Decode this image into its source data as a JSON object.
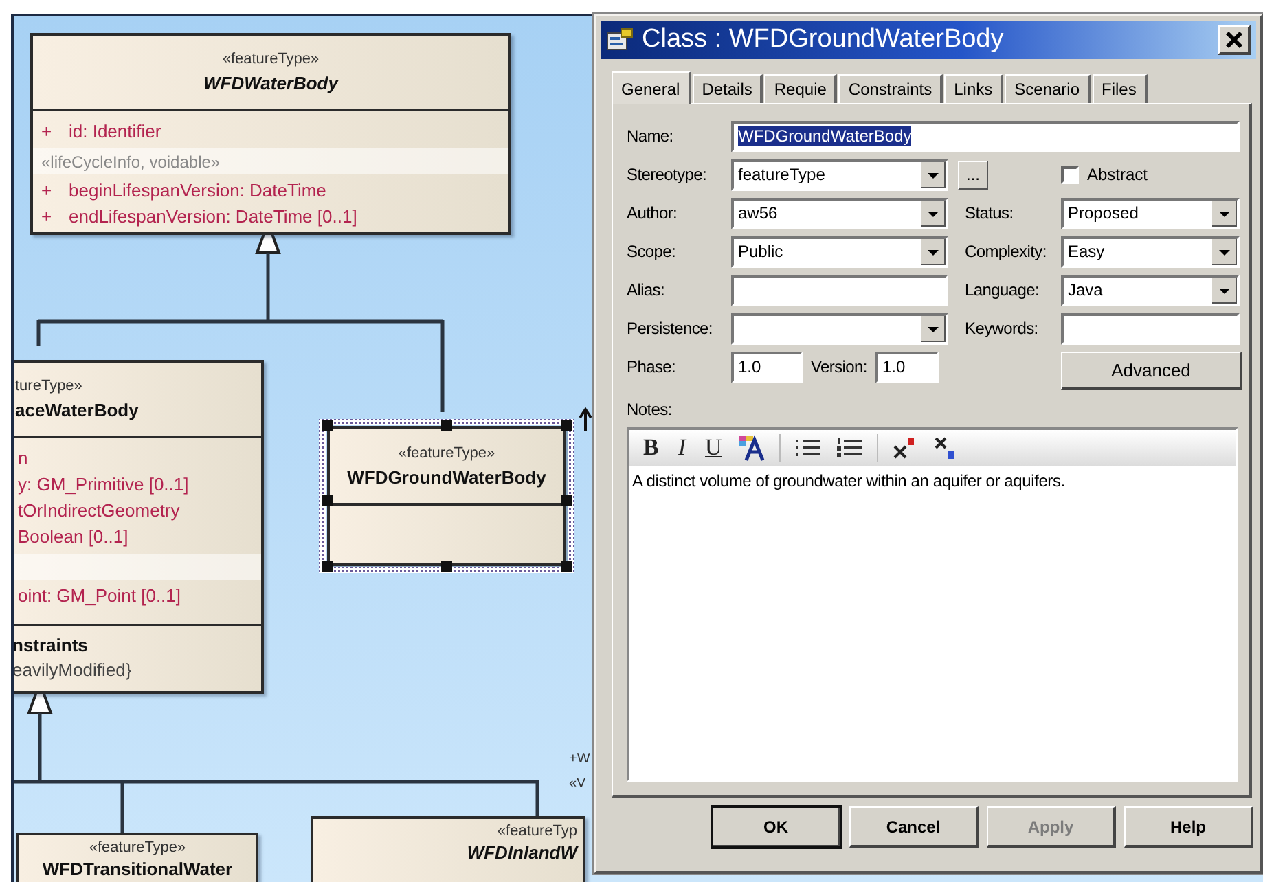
{
  "diagram": {
    "classes": [
      {
        "stereotype": "«featureType»",
        "name": "WFDWaterBody",
        "abstract": true,
        "selected": false,
        "attributes": [
          {
            "kind": "attribute",
            "visibility": "+",
            "text": "id: Identifier"
          },
          {
            "kind": "band",
            "text": "«lifeCycleInfo, voidable»"
          },
          {
            "kind": "attribute",
            "visibility": "+",
            "text": "beginLifespanVersion:  DateTime"
          },
          {
            "kind": "attribute",
            "visibility": "+",
            "text": "endLifespanVersion:  DateTime [0..1]"
          }
        ]
      },
      {
        "stereotype": "tureType»",
        "name": "aceWaterBody",
        "abstract": false,
        "selected": false,
        "attributes": [
          {
            "kind": "attribute",
            "text": "n"
          },
          {
            "kind": "attribute",
            "text": "y:  GM_Primitive [0..1]"
          },
          {
            "kind": "attribute",
            "text": "tOrIndirectGeometry"
          },
          {
            "kind": "attribute",
            "text": "Boolean [0..1]"
          },
          {
            "kind": "band"
          },
          {
            "kind": "attribute",
            "text": "oint:  GM_Point [0..1]"
          }
        ],
        "constraints": {
          "title": "nstraints",
          "items": [
            "eavilyModified}"
          ]
        }
      },
      {
        "stereotype": "«featureType»",
        "name": "WFDGroundWaterBody",
        "abstract": false,
        "selected": true
      },
      {
        "stereotype": "«featureType»",
        "name": "WFDTransitionalWater",
        "abstract": false,
        "selected": false
      },
      {
        "stereotype": "«featureTyp",
        "name": "WFDInlandW",
        "abstract": true,
        "selected": false
      }
    ],
    "labels": [
      {
        "text": "+W"
      },
      {
        "text": "«V"
      }
    ]
  },
  "dialog": {
    "title": "Class : WFDGroundWaterBody",
    "tabs": [
      {
        "label": "General",
        "selected": true
      },
      {
        "label": "Details",
        "selected": false
      },
      {
        "label": "Requie",
        "selected": false
      },
      {
        "label": "Constraints",
        "selected": false
      },
      {
        "label": "Links",
        "selected": false
      },
      {
        "label": "Scenario",
        "selected": false
      },
      {
        "label": "Files",
        "selected": false
      }
    ],
    "name": {
      "label": "Name:",
      "value": "WFDGroundWaterBody",
      "selected": true
    },
    "left_fields": [
      {
        "label": "Stereotype:",
        "kind": "combo",
        "value": "featureType"
      },
      {
        "label": "Author:",
        "kind": "combo",
        "value": "aw56"
      },
      {
        "label": "Scope:",
        "kind": "combo",
        "value": "Public"
      },
      {
        "label": "Alias:",
        "kind": "text"
      },
      {
        "label": "Persistence:",
        "kind": "combo"
      }
    ],
    "browse_button": "...",
    "abstract": {
      "label": "Abstract",
      "checked": false
    },
    "right_fields": [
      {
        "label": "Status:",
        "kind": "combo",
        "value": "Proposed"
      },
      {
        "label": "Complexity:",
        "kind": "combo",
        "value": "Easy"
      },
      {
        "label": "Language:",
        "kind": "combo",
        "value": "Java"
      },
      {
        "label": "Keywords:",
        "kind": "text"
      }
    ],
    "phase": {
      "label": "Phase:",
      "value": "1.0"
    },
    "version": {
      "label": "Version:",
      "value": "1.0"
    },
    "advanced_button": "Advanced",
    "notes": {
      "label": "Notes:",
      "toolbar": [
        {
          "kind": "bold",
          "label": "B"
        },
        {
          "kind": "italic",
          "label": "I"
        },
        {
          "kind": "underline",
          "label": "U"
        },
        {
          "kind": "text-color"
        },
        {
          "kind": "separator"
        },
        {
          "kind": "bullets"
        },
        {
          "kind": "numbering"
        },
        {
          "kind": "separator"
        },
        {
          "kind": "superscript"
        },
        {
          "kind": "subscript"
        }
      ],
      "text": "A distinct volume of groundwater within an aquifer or aquifers."
    },
    "buttons": [
      {
        "label": "OK",
        "default": true,
        "disabled": false
      },
      {
        "label": "Cancel",
        "default": false,
        "disabled": false
      },
      {
        "label": "Apply",
        "default": false,
        "disabled": true
      },
      {
        "label": "Help",
        "default": false,
        "disabled": false
      }
    ]
  }
}
